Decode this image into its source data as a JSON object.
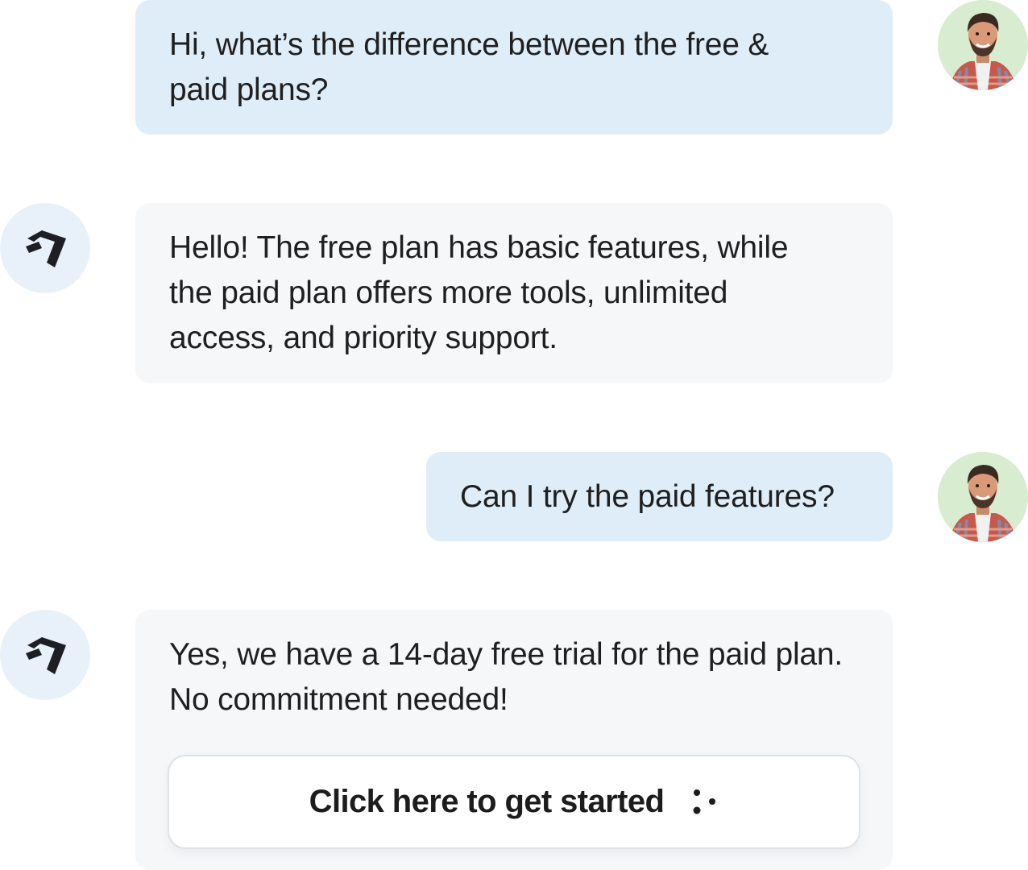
{
  "conversation": {
    "messages": [
      {
        "role": "user",
        "lines": [
          "Hi, what’s the difference between the free &",
          "paid plans?"
        ]
      },
      {
        "role": "assistant",
        "lines": [
          "Hello! The free plan has basic features, while",
          "the paid plan offers more tools, unlimited",
          "access, and priority support."
        ]
      },
      {
        "role": "user",
        "lines": [
          "Can I try the paid features?"
        ]
      },
      {
        "role": "assistant",
        "lines": [
          "Yes, we have a 14-day free trial for the paid plan.",
          "No commitment needed!"
        ]
      }
    ],
    "cta": {
      "label": "Click here to get started",
      "icon": "loading-dots-icon"
    }
  },
  "icons": {
    "user_avatar": "user-avatar-photo",
    "assistant_avatar": "brand-logo-icon"
  },
  "colors": {
    "user_bubble": "#dfedf8",
    "assistant_bubble": "#f5f7f9",
    "assistant_avatar_bg": "#e8f1fa",
    "user_avatar_bg": "#d8ecd0",
    "text": "#1f1f1f"
  }
}
